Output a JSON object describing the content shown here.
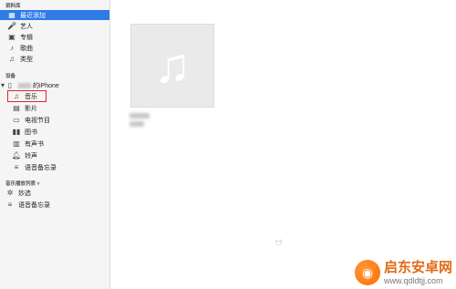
{
  "sidebar": {
    "library_header": "资料库",
    "library_items": [
      {
        "label": "最近添加",
        "icon": "recently-added-icon",
        "selected": true
      },
      {
        "label": "艺人",
        "icon": "artist-icon"
      },
      {
        "label": "专辑",
        "icon": "album-icon"
      },
      {
        "label": "歌曲",
        "icon": "song-icon"
      },
      {
        "label": "类型",
        "icon": "genre-icon"
      }
    ],
    "devices_header": "设备",
    "device_name": "的iPhone",
    "device_items": [
      {
        "label": "音乐",
        "icon": "music-note-icon",
        "highlighted": true
      },
      {
        "label": "影片",
        "icon": "film-icon"
      },
      {
        "label": "电视节目",
        "icon": "tv-icon"
      },
      {
        "label": "图书",
        "icon": "book-icon"
      },
      {
        "label": "有声书",
        "icon": "audiobook-icon"
      },
      {
        "label": "铃声",
        "icon": "bell-icon"
      },
      {
        "label": "语音备忘录",
        "icon": "voice-memo-icon"
      }
    ],
    "playlists_header": "音乐播放列表 ˅",
    "playlist_items": [
      {
        "label": "妙选",
        "icon": "genius-icon"
      },
      {
        "label": "语音备忘录",
        "icon": "voice-memo-icon"
      }
    ]
  },
  "main": {
    "artwork_icon": "music-note-icon"
  },
  "watermark": {
    "title": "启东安卓网",
    "url": "www.qdldtjj.com",
    "accent": "#e06a14"
  },
  "colors": {
    "selection": "#2f7ae5",
    "highlight_border": "#d9272e"
  }
}
